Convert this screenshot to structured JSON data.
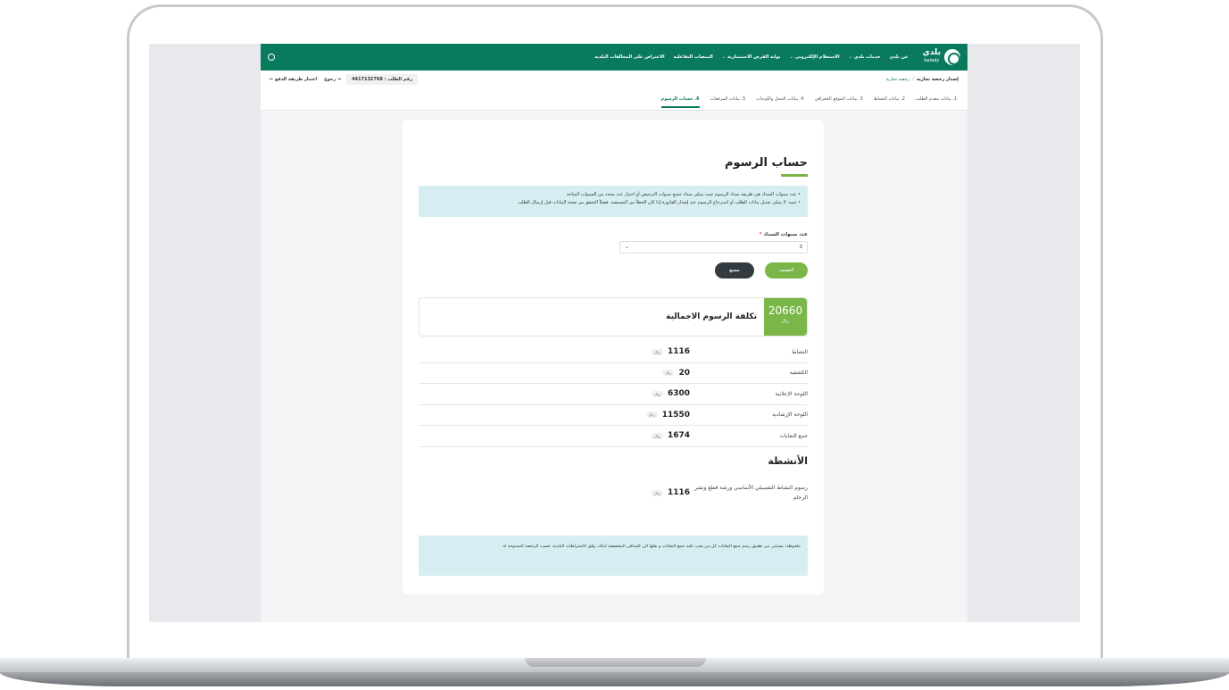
{
  "header": {
    "logo_text": "بلدي",
    "logo_sub": "balady",
    "nav": [
      "عن بلدي",
      "خدمات بلدي",
      "الاستعلام الإلكتروني",
      "بوابة الفرص الاستثمارية",
      "المنصات التفاعلية",
      "الاعتراض على المخالفات البلدية"
    ]
  },
  "subheader": {
    "title": "إصدار رخصة تجارية",
    "separator": "/",
    "current": "رخصة تجارية",
    "request_no": "رقم الطلب : 4417132768",
    "back": "رجوع",
    "pay_method": "اختيار طريقة الدفع"
  },
  "steps": [
    "1. بيانات مقدم الطلب",
    "2. بيانات النشاط",
    "3. بيانات الموقع الجغرافي",
    "4. بيانات المحل واللوحات",
    "5. بيانات المرفقات",
    "6. حساب الرسوم"
  ],
  "card": {
    "title": "حساب الرسوم",
    "info": [
      "عدد سنوات السداد هي طريقة سداد الرسوم حيث يمكن سداد جميع سنوات الترخيص أو اختيار عدد محدد من السنوات المتاحة",
      "تنبيه: لا يمكن تعديل بيانات الطلب أو استرجاع الرسوم عند إصدار الفاتورة إذا كان الخطأ من المستفيد، فضلاً التحقق من صحة البيانات قبل إرسال الطلب"
    ],
    "years_label": "عدد سنوات السداد",
    "years_value": "3",
    "calc_button": "احسب",
    "clear_button": "مسح",
    "total_amount": "20660",
    "currency": "ريال",
    "total_label": "تكلفة الرسوم الاجمالية",
    "fees": [
      {
        "name": "النشاط",
        "value": "1116"
      },
      {
        "name": "الكشفية",
        "value": "20"
      },
      {
        "name": "اللوحة الإعلانية",
        "value": "6300"
      },
      {
        "name": "اللوحة الإرشادية",
        "value": "11550"
      },
      {
        "name": "جمع النفايات",
        "value": "1674"
      }
    ],
    "activities_title": "الأنشطة",
    "activity": {
      "name": "رسوم النشاط التفصيلي الأساسي ورشة قطع ونشر الرخام",
      "value": "1116"
    },
    "note": "ملحوظة: يستثنى من تطبيق رسم جمع النفايات كل من يجب عليه جمع النفايات و نقلها الى المدافن المخصصة لذلك، وفق الاشتراطات البلدية، حسب الرخصة الممنوحة له"
  },
  "colors": {
    "brand": "#0a7a5f",
    "accent": "#7ab648",
    "info_bg": "#d6eef2"
  }
}
